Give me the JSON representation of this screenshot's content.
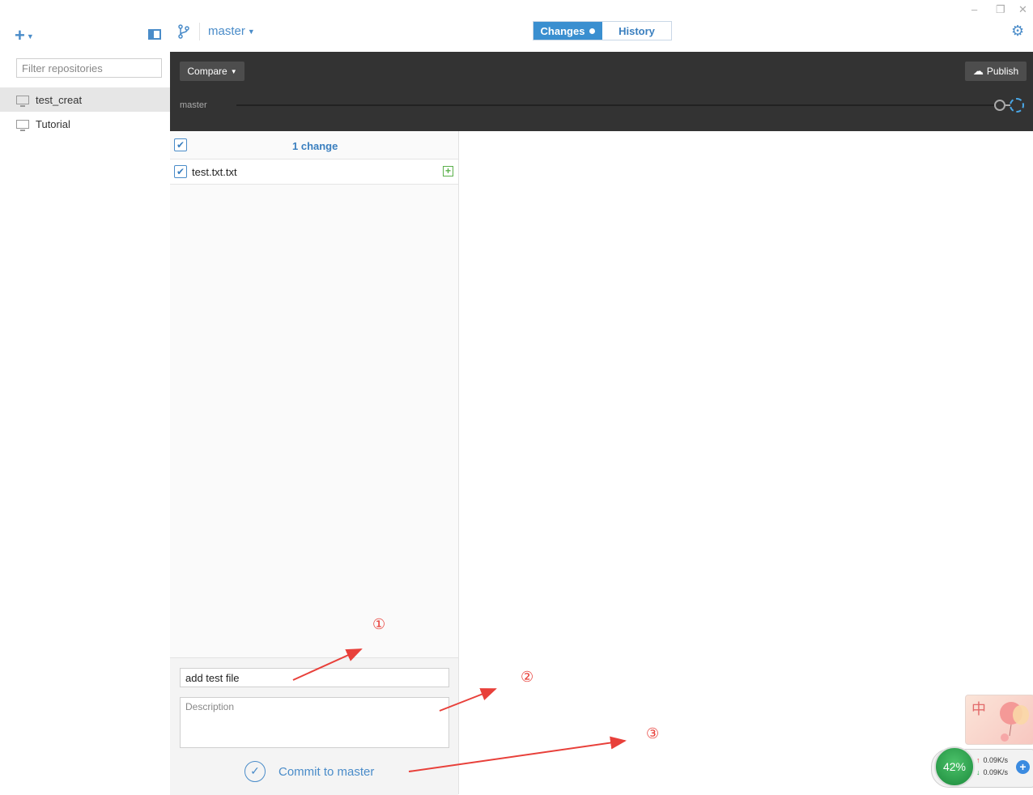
{
  "window": {
    "minimize": "‒",
    "restore": "❐",
    "close": "✕"
  },
  "sidebar": {
    "add": "+",
    "filter_placeholder": "Filter repositories",
    "repos": [
      {
        "label": "test_creat",
        "selected": true
      },
      {
        "label": "Tutorial",
        "selected": false
      }
    ]
  },
  "topbar": {
    "branch": "master",
    "tabs": [
      {
        "label": "Changes"
      },
      {
        "label": "History"
      }
    ]
  },
  "toolbar": {
    "compare_label": "Compare",
    "publish_label": "Publish",
    "timeline_branch": "master"
  },
  "changes": {
    "count_label": "1 change",
    "files": [
      {
        "name": "test.txt.txt",
        "status": "added"
      }
    ]
  },
  "commit": {
    "summary_value": "add test file",
    "description_placeholder": "Description",
    "button_label": "Commit to master"
  },
  "annotations": [
    "①",
    "②",
    "③"
  ],
  "widgets": {
    "ime_char": "中",
    "cpu_percent": "42%",
    "upload": "0.09K/s",
    "download": "0.09K/s"
  },
  "colors": {
    "accent": "#3a8fd0",
    "dark_band": "#333333",
    "annotation": "#e8403a",
    "added": "#5ab04a"
  }
}
